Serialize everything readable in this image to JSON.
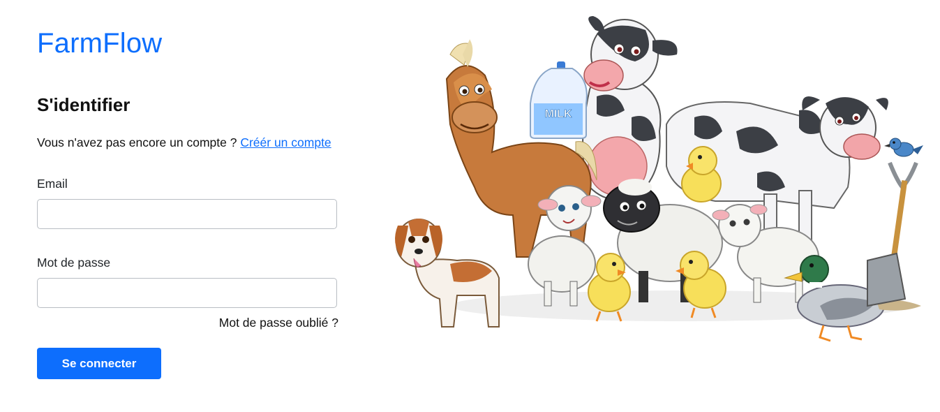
{
  "brand": {
    "name": "FarmFlow"
  },
  "login": {
    "title": "S'identifier",
    "no_account_text": "Vous n'avez pas encore un compte ?",
    "create_account_link": "Créér un compte",
    "email_label": "Email",
    "email_value": "",
    "password_label": "Mot de passe",
    "password_value": "",
    "forgot_password": "Mot de passe oublié ?",
    "submit_label": "Se connecter"
  },
  "illustration": {
    "milk_label": "MILK"
  },
  "colors": {
    "accent": "#0d6efd",
    "text": "#212529",
    "input_border": "#b8bdc3"
  }
}
